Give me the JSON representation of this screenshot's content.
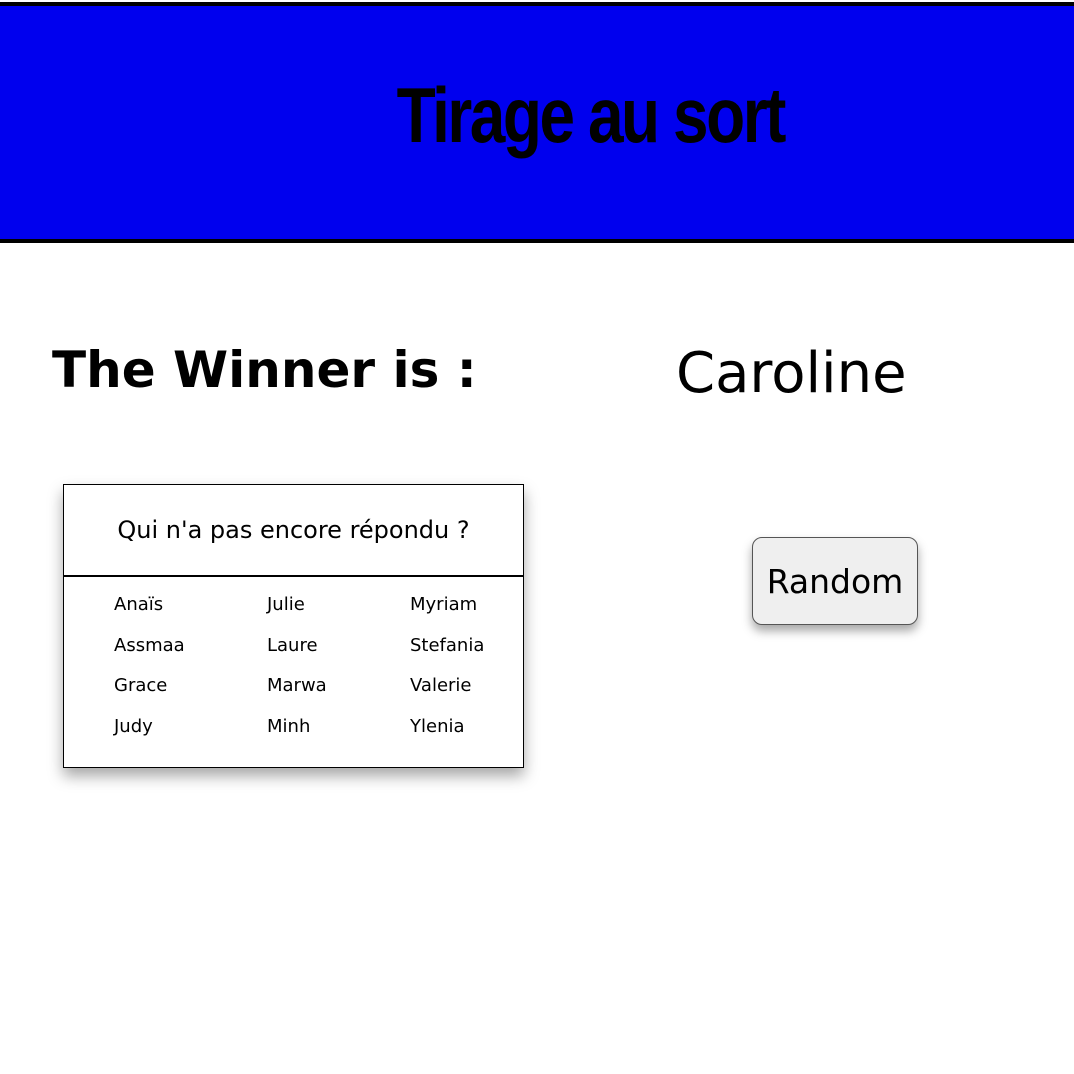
{
  "header": {
    "title": "Tirage au sort",
    "background_color": "#0000ee"
  },
  "winner": {
    "label": "The Winner is :",
    "name": "Caroline"
  },
  "pending": {
    "title": "Qui n'a pas encore répondu ?",
    "names": [
      "Anaïs",
      "Julie",
      "Myriam",
      "Assmaa",
      "Laure",
      "Stefania",
      "Grace",
      "Marwa",
      "Valerie",
      "Judy",
      "Minh",
      "Ylenia"
    ]
  },
  "actions": {
    "random_label": "Random"
  }
}
